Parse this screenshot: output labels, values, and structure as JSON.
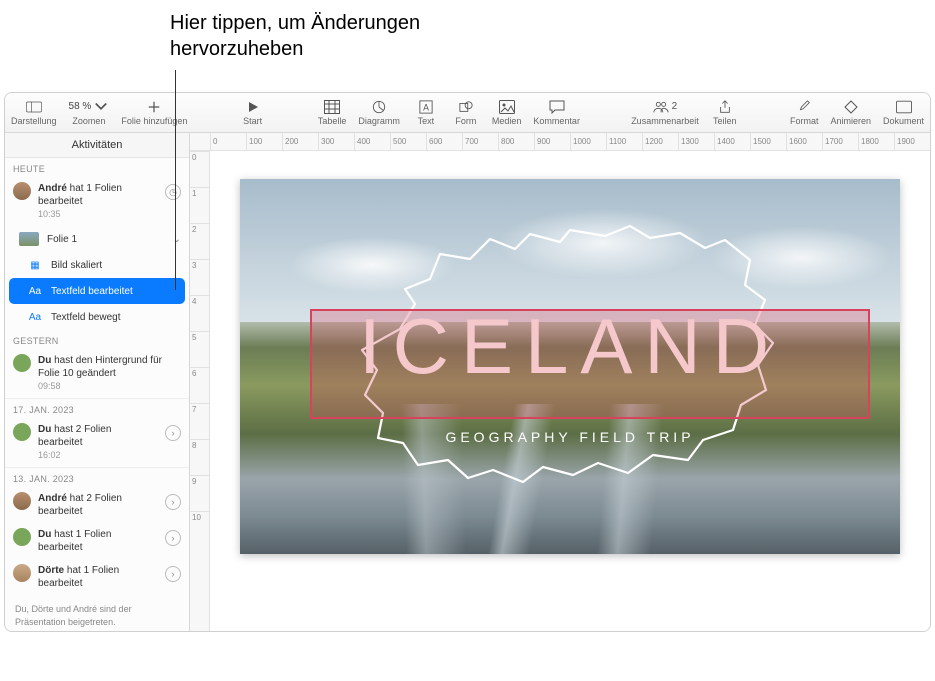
{
  "callout": {
    "line1": "Hier tippen, um Änderungen",
    "line2": "hervorzuheben"
  },
  "toolbar": {
    "view": "Darstellung",
    "zoom_label": "Zoomen",
    "zoom_value": "58 %",
    "add_slide": "Folie hinzufügen",
    "play": "Start",
    "table": "Tabelle",
    "chart": "Diagramm",
    "text": "Text",
    "shape": "Form",
    "media": "Medien",
    "comment": "Kommentar",
    "collab": "Zusammenarbeit",
    "collab_count": "2",
    "share": "Teilen",
    "format": "Format",
    "animate": "Animieren",
    "document": "Dokument"
  },
  "sidebar": {
    "title": "Aktivitäten",
    "sections": {
      "today": "HEUTE",
      "yesterday": "GESTERN",
      "jan17": "17. JAN. 2023",
      "jan13": "13. JAN. 2023"
    },
    "today_item": {
      "user": "André",
      "text": " hat 1 Folien bearbeitet",
      "time": "10:35"
    },
    "slide_expand": {
      "label": "Folie 1"
    },
    "changes": {
      "c1": "Bild skaliert",
      "c2": "Textfeld bearbeitet",
      "c3": "Textfeld bewegt"
    },
    "yesterday_item": {
      "userline": "Du",
      "rest": " hast den Hintergrund für Folie 10 geändert",
      "time": "09:58"
    },
    "jan17_item": {
      "userline": "Du",
      "rest": " hast 2 Folien bearbeitet",
      "time": "16:02"
    },
    "jan13_items": [
      {
        "user": "André",
        "rest": " hat 2 Folien bearbeitet"
      },
      {
        "user": "Du",
        "rest": " hast 1 Folien bearbeitet"
      },
      {
        "user": "Dörte",
        "rest": " hat 1 Folien bearbeitet"
      }
    ],
    "footer": "Du, Dörte und André sind der Präsentation beigetreten."
  },
  "ruler_h": [
    "0",
    "100",
    "200",
    "300",
    "400",
    "500",
    "600",
    "700",
    "800",
    "900",
    "1000",
    "1100",
    "1200",
    "1300",
    "1400",
    "1500",
    "1600",
    "1700",
    "1800",
    "1900"
  ],
  "ruler_v": [
    "0",
    "1",
    "2",
    "3",
    "4",
    "5",
    "6",
    "7",
    "8",
    "9",
    "10"
  ],
  "slide": {
    "title": "ICELAND",
    "subtitle": "GEOGRAPHY FIELD TRIP"
  }
}
